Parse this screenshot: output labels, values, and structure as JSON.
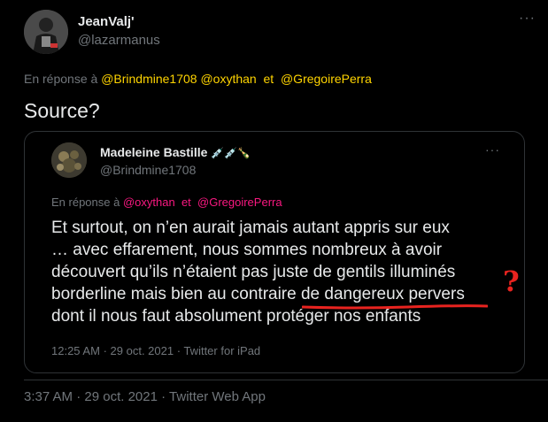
{
  "tweet": {
    "author_name": "JeanValj'",
    "author_handle": "@lazarmanus",
    "more_icon": "more-horizontal-icon",
    "reply_prefix": "En réponse à",
    "reply_mention_1": "@Brindmine1708",
    "reply_mention_2": "@oxythan",
    "reply_and": "et",
    "reply_mention_3": "@GregoirePerra",
    "text": "Source?",
    "time": "3:37 AM",
    "date": "29 oct. 2021",
    "source": "Twitter Web App",
    "dot": "·"
  },
  "quoted": {
    "author_name": "Madeleine Bastille",
    "author_emoji": "💉💉🍾",
    "author_handle": "@Brindmine1708",
    "reply_prefix": "En réponse à",
    "reply_mention_1": "@oxythan",
    "reply_and": "et",
    "reply_mention_2": "@GregoirePerra",
    "lines": [
      "Et surtout, on n’en aurait jamais autant appris sur eux",
      "… avec effarement, nous sommes nombreux à avoir",
      "découvert qu’ils n’étaient pas juste de gentils illuminés",
      "borderline mais bien au contraire de dangereux pervers",
      "dont il nous faut absolument protéger nos enfants"
    ],
    "time": "12:25 AM",
    "date": "29 oct. 2021",
    "source": "Twitter for iPad",
    "dot": "·"
  },
  "annotation": {
    "question_mark": "?",
    "color": "#e8231f"
  },
  "colors": {
    "background": "#000000",
    "text": "#e7e9ea",
    "muted": "#71767b",
    "mention_yellow": "#ffd400",
    "mention_pink": "#f91880",
    "border": "#2f3336"
  }
}
